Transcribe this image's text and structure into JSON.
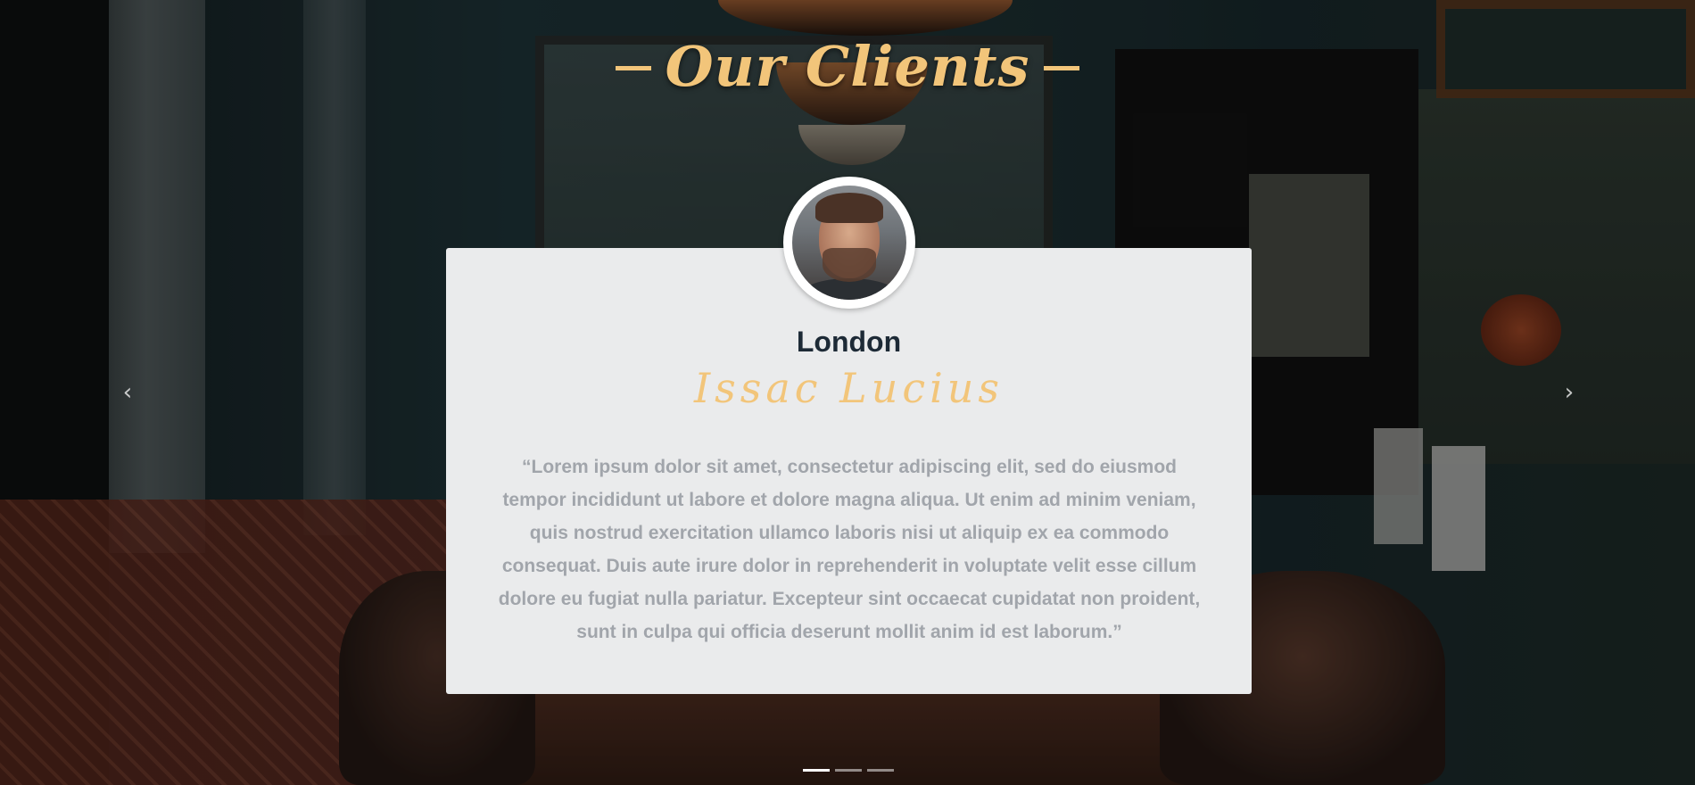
{
  "section": {
    "title": "Our Clients"
  },
  "carousel": {
    "prev_icon": "chevron-left-icon",
    "next_icon": "chevron-right-icon",
    "indicator_count": 3,
    "active_indicator": 1
  },
  "testimonial": {
    "avatar": "client-portrait",
    "city": "London",
    "name": "Issac Lucius",
    "quote": "“Lorem ipsum dolor sit amet, consectetur adipiscing elit, sed do eiusmod tempor incididunt ut labore et dolore magna aliqua. Ut enim ad minim veniam, quis nostrud exercitation ullamco laboris nisi ut aliquip ex ea commodo consequat. Duis aute irure dolor in reprehenderit in voluptate velit esse cillum dolore eu fugiat nulla pariatur. Excepteur sint occaecat cupidatat non proident, sunt in culpa qui officia deserunt mollit anim id est laborum.”"
  },
  "colors": {
    "accent_gold": "#f2c57a",
    "card_background": "#eaebec",
    "city_text": "#1d2a36",
    "quote_text": "#a1a5ab"
  }
}
